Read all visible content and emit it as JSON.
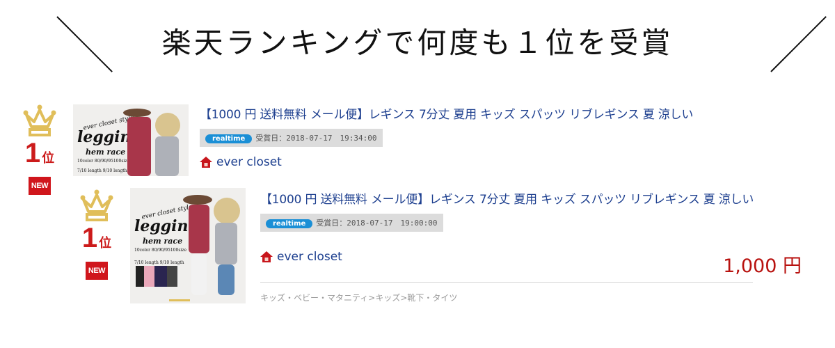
{
  "heading": "楽天ランキングで何度も１位を受賞",
  "colors": {
    "title_link": "#1d3f8f",
    "rank_red": "#cc1b1b",
    "crown_gold": "#e0be5a",
    "realtime_blue": "#1a8fd6",
    "price_red": "#b8120f"
  },
  "entries": [
    {
      "rank_number": "1",
      "rank_suffix": "位",
      "badge": "NEW",
      "thumbnail": {
        "line1": "ever closet style",
        "line2": "leggings",
        "line3": "hem race",
        "line4": "10color 80/90/95100size",
        "line5": "7/10 length   9/10 length"
      },
      "title": "【1000 円 送料無料 メール便】レギンス 7分丈 夏用 キッズ スパッツ リブレギンス 夏 涼しい",
      "realtime_label": "realtime",
      "award_date": "受賞日：2018-07-17　19:34:00",
      "shop_name": "ever closet"
    },
    {
      "rank_number": "1",
      "rank_suffix": "位",
      "badge": "NEW",
      "thumbnail": {
        "line1": "ever closet style",
        "line2": "leggings",
        "line3": "hem race",
        "line4": "10color 80/90/95100size",
        "line5": "7/10 length   9/10 length"
      },
      "title": "【1000 円 送料無料 メール便】レギンス 7分丈 夏用 キッズ スパッツ リブレギンス 夏 涼しい",
      "realtime_label": "realtime",
      "award_date": "受賞日：2018-07-17　19:00:00",
      "shop_name": "ever closet",
      "price": "1,000 円",
      "category": "キッズ・ベビー・マタニティ>キッズ>靴下・タイツ"
    }
  ]
}
